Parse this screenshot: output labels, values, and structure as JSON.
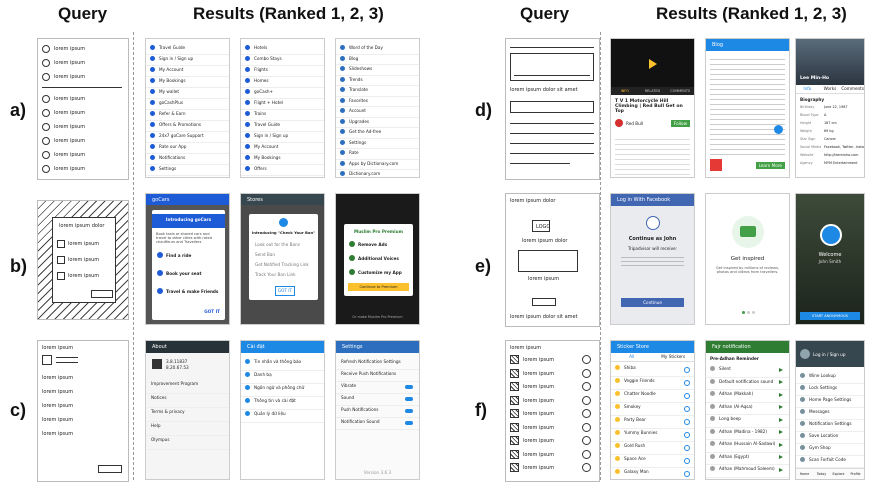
{
  "headers": {
    "query_left": "Query",
    "results_left": "Results (Ranked 1, 2, 3)",
    "query_right": "Query",
    "results_right": "Results (Ranked 1, 2, 3)"
  },
  "rows": {
    "a": "a)",
    "b": "b)",
    "c": "c)",
    "d": "d)",
    "e": "e)",
    "f": "f)"
  },
  "sketch_text": {
    "lorem": "lorem ipsum",
    "lorem_dolor": "lorem ipsum dolor",
    "lorem_dolor_sit": "lorem ipsum dolor sit amet",
    "login": "LOGO"
  },
  "a1": {
    "items": [
      "Travel Guide",
      "Sign in / Sign up",
      "My Account",
      "My Bookings",
      "My wallet",
      "goCashPlus",
      "Refer & Earn",
      "Offers & Promotions",
      "24x7 goCare Support",
      "Rate our App",
      "Notifications",
      "Settings"
    ]
  },
  "a2": {
    "items": [
      "Hotels",
      "Combo Stays",
      "Flights",
      "Homes",
      "goCash+",
      "Flight + Hotel",
      "Trains",
      "Travel Guide",
      "Sign in / Sign up",
      "My Account",
      "My Bookings",
      "Offers"
    ]
  },
  "a3": {
    "items": [
      "Word of the Day",
      "Blog",
      "Slideshows",
      "Trends",
      "Translate",
      "Favorites",
      "Account",
      "Upgrades",
      "Get the Ad-free",
      "Settings",
      "Rate",
      "Apps by Dictionary.com",
      "Dictionary.com"
    ]
  },
  "b1": {
    "bar": "goCars",
    "title": "Introducing goCars",
    "intro": "Book taxis or shared cars and travel to other cities with rated chauffeurs and Travellers",
    "items": [
      "Find a ride",
      "Book your seat",
      "Travel & make Friends"
    ],
    "action": "GOT IT"
  },
  "b2": {
    "bar": "Stores",
    "title": "Introducing \"Check Your Ban\"",
    "items": [
      "Look out for the Bans",
      "Send Ban",
      "Get Notified Tracking Link",
      "Track Your Ban Link"
    ],
    "action": "GOT IT"
  },
  "b3": {
    "title": "Muslim Pro Premium",
    "items": [
      "Remove Ads",
      "Additional Voices",
      "Customize my App"
    ],
    "action": "Continue to Premium",
    "foot": "Or make Muslim Pro Premium"
  },
  "c1": {
    "bar": "About",
    "version": "3.8.11837",
    "version2": "8.20.67.53",
    "items": [
      "Improvement Program",
      "Notices",
      "Terms & privacy",
      "Help",
      "Olympus"
    ]
  },
  "c2": {
    "bar": "Cài đặt",
    "items": [
      "Tin nhắn và thông báo",
      "Danh bạ",
      "Ngôn ngữ và phông chữ",
      "Thông tin và cài đặt",
      "Quản lý dữ liệu"
    ]
  },
  "c3": {
    "bar": "Settings",
    "items": [
      "Refresh Notification Settings",
      "Receive Push Notifications",
      "Vibrate",
      "Sound",
      "Push Notifications",
      "Notification Sound"
    ],
    "foot": "Version 3.6.3"
  },
  "d1": {
    "title": "T V 1 Motorcycle Hill Climbing | Red Bull Get on Top",
    "tabs": [
      "INFO",
      "RELATED VIDEOS",
      "COMMENTS"
    ],
    "channel": "Red Bull",
    "subscribe": "Follow"
  },
  "d2": {
    "bar": "Blog",
    "action": "Learn More"
  },
  "d3": {
    "name": "Lee Min-Ho",
    "tabs": [
      "Info",
      "Works",
      "Comments"
    ],
    "section": "Biography",
    "fields": [
      "Birthday",
      "Blood Type",
      "Height",
      "Weight",
      "Star Sign",
      "Social Media",
      "Website",
      "Agency"
    ],
    "values": [
      "June 22, 1987",
      "A",
      "187 cm",
      "69 kg",
      "Cancer",
      "Facebook, Twitter, Instagram",
      "http://leeminho.com",
      "MYM Entertainment"
    ]
  },
  "e1": {
    "bar": "Log in With Facebook",
    "title": "Continue as John",
    "sub": "Tripadvisor will receive:",
    "action": "Continue"
  },
  "e2": {
    "title": "Get inspired",
    "desc": "Get inspired by millions of reviews, photos and videos from travellers."
  },
  "e3": {
    "title": "Welcome",
    "name": "John Smith",
    "action": "START ANONYMOUS"
  },
  "f1": {
    "bar": "Sticker Store",
    "tabs": [
      "All",
      "My Stickers"
    ],
    "items": [
      "Shiba",
      "Veggie Friends",
      "Chatter Noodle",
      "Smokey",
      "Party Bear",
      "Yummy Bunnies",
      "Gold Rush",
      "Space Ace",
      "Galaxy Man"
    ]
  },
  "f2": {
    "bar": "Fajr notification",
    "head": "Pre-Adhan Reminder",
    "items": [
      "Silent",
      "Default notification sound",
      "Adhan (Makkah)",
      "Adhan (Al-Aqsa)",
      "Long beep",
      "Adhan (Madina - 1982)",
      "Adhan (Hussain Al-Sadawi)",
      "Adhan (Egypt)",
      "Adhan (Mahmoud Saleem)"
    ]
  },
  "f3": {
    "bar": "Log in / Sign up",
    "items": [
      "Wine Lookup",
      "Lock Settings",
      "Home Page Settings",
      "Messages",
      "Notification Settings",
      "Save Location",
      "Gym Shop",
      "Scan Forfait Code"
    ],
    "tabs": [
      "Home",
      "Today",
      "Explore",
      "Profile"
    ]
  },
  "colors": {
    "goibibo_blue": "#1e5bd6",
    "dictionary_blue": "#2d6fbe",
    "dark": "#263238",
    "youtube_dark": "#111111",
    "blog_blue": "#1e88e5",
    "facebook_blue": "#4267b2",
    "green": "#43a047",
    "muslim_green": "#2e7d32"
  }
}
